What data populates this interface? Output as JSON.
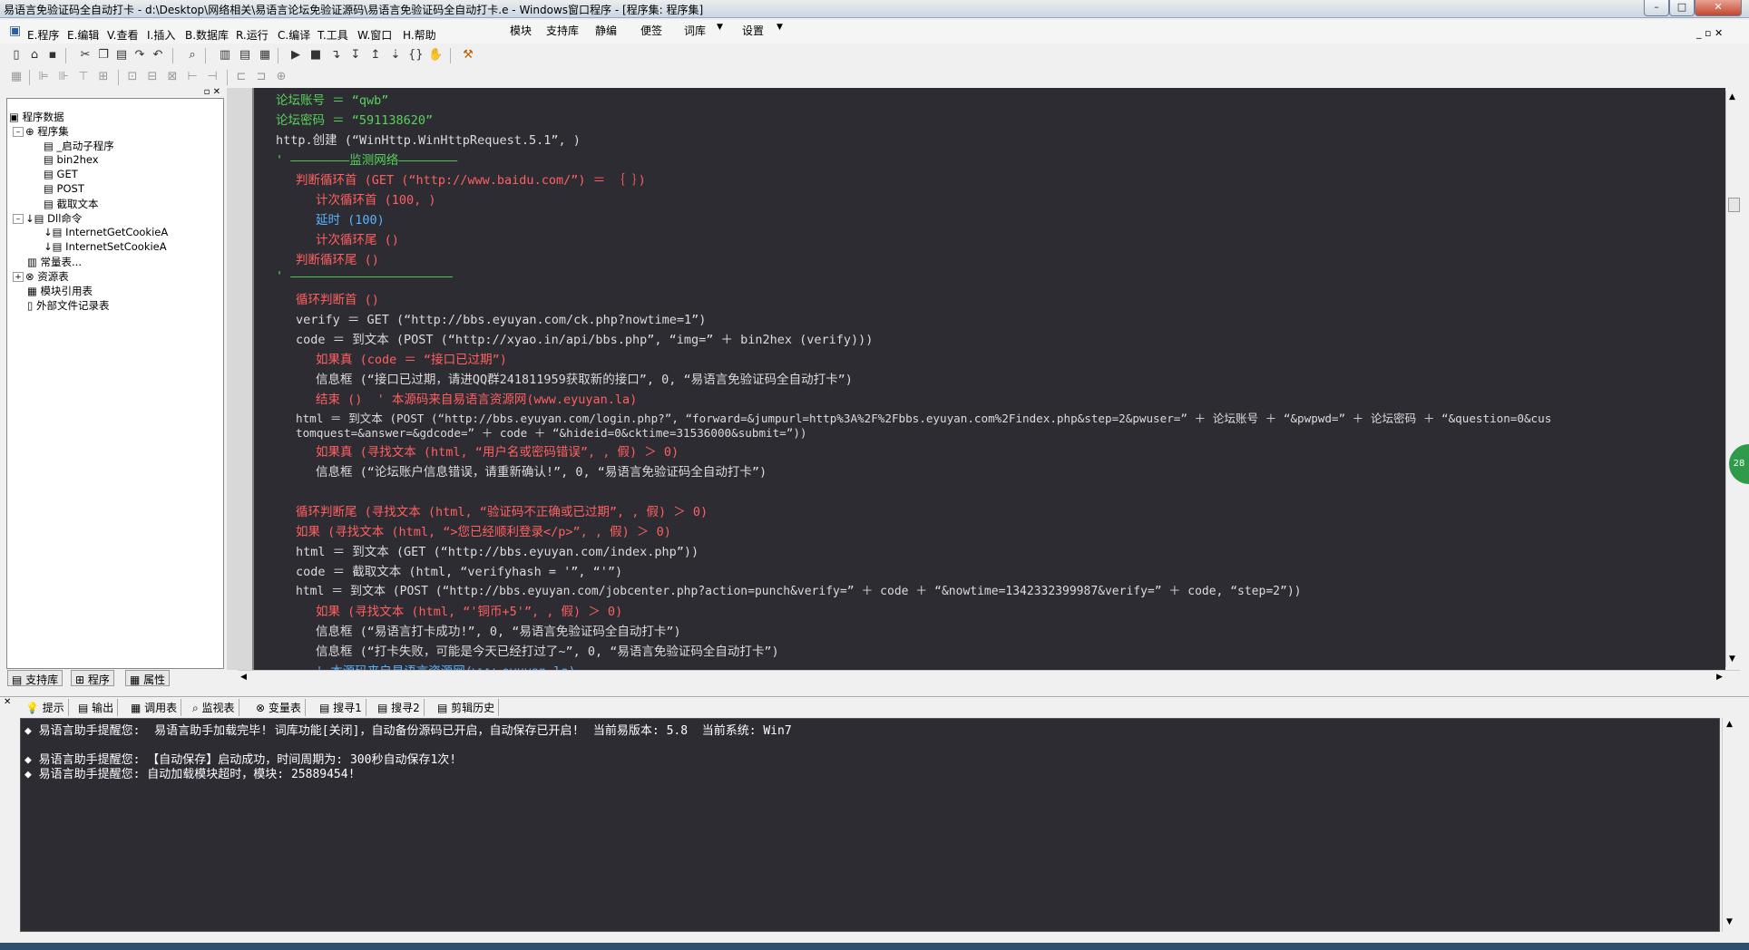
{
  "window": {
    "title": "易语言免验证码全自动打卡 - d:\\Desktop\\网络相关\\易语言论坛免验证源码\\易语言免验证码全自动打卡.e - Windows窗口程序 - [程序集: 程序集]",
    "min": "–",
    "max": "□",
    "close": "✕"
  },
  "menu": [
    "E.程序",
    "E.编辑",
    "V.查看",
    "I.插入",
    "B.数据库",
    "R.运行",
    "C.编译",
    "T.工具",
    "W.窗口",
    "H.帮助"
  ],
  "topmenu": [
    "模块",
    "支持库",
    "静编",
    "便签",
    "词库",
    "设置"
  ],
  "tree": {
    "root": "程序数据",
    "assembly": "程序集",
    "items": [
      "_启动子程序",
      "bin2hex",
      "GET",
      "POST",
      "截取文本"
    ],
    "dll": "Dll命令",
    "dll_items": [
      "InternetGetCookieA",
      "InternetSetCookieA"
    ],
    "consts": "常量表...",
    "resources": "资源表",
    "modref": "模块引用表",
    "external": "外部文件记录表"
  },
  "left_tabs": [
    "支持库",
    "程序",
    "属性"
  ],
  "code": [
    "论坛账号 ＝ “qwb”",
    "论坛密码 ＝ “591138620”",
    "http.创建 (“WinHttp.WinHttpRequest.5.1”, )",
    "' ————————监测网络————————",
    "判断循环首 (GET (“http://www.baidu.com/”) ＝ ｛ ｝)",
    "计次循环首 (100, )",
    "延时 (100)",
    "计次循环尾 ()",
    "判断循环尾 ()",
    "' ——————————————————————",
    "循环判断首 ()",
    "verify ＝ GET (“http://bbs.eyuyan.com/ck.php?nowtime=1”)",
    "code ＝ 到文本 (POST (“http://xyao.in/api/bbs.php”, “img=” ＋ bin2hex (verify)))",
    "如果真 (code ＝ “接口已过期”)",
    "信息框 (“接口已过期，请进QQ群241811959获取新的接口”, 0, “易语言免验证码全自动打卡”)",
    "结束 ()  ' 本源码来自易语言资源网(www.eyuyan.la)",
    "html ＝ 到文本 (POST (“http://bbs.eyuyan.com/login.php?”, “forward=&jumpurl=http%3A%2F%2Fbbs.eyuyan.com%2Findex.php&step=2&pwuser=” ＋ 论坛账号 ＋ “&pwpwd=” ＋ 论坛密码 ＋ “&question=0&cus",
    "tomquest=&answer=&gdcode=” ＋ code ＋ “&hideid=0&cktime=31536000&submit=”))",
    "如果真 (寻找文本 (html, “用户名或密码错误”, , 假) ＞ 0)",
    "信息框 (“论坛账户信息错误，请重新确认!”, 0, “易语言免验证码全自动打卡”)",
    "循环判断尾 (寻找文本 (html, “验证码不正确或已过期”, , 假) ＞ 0)",
    "如果 (寻找文本 (html, “>您已经顺利登录</p>”, , 假) ＞ 0)",
    "html ＝ 到文本 (GET (“http://bbs.eyuyan.com/index.php”))",
    "code ＝ 截取文本 (html, “verifyhash = '”, “'”)",
    "html ＝ 到文本 (POST (“http://bbs.eyuyan.com/jobcenter.php?action=punch&verify=” ＋ code ＋ “&nowtime=1342332399987&verify=” ＋ code, “step=2”))",
    "如果 (寻找文本 (html, “'铜币+5'”, , 假) ＞ 0)",
    "信息框 (“易语言打卡成功!”, 0, “易语言免验证码全自动打卡”)",
    "信息框 (“打卡失败，可能是今天已经打过了~”, 0, “易语言免验证码全自动打卡”)",
    "' 本源码来自易语言资源网(www.eyuyan.la)"
  ],
  "bottom_tabs": [
    "提示",
    "输出",
    "调用表",
    "监视表",
    "变量表",
    "搜寻1",
    "搜寻2",
    "剪辑历史"
  ],
  "output": [
    "◆ 易语言助手提醒您:  易语言助手加载完毕! 词库功能[关闭]，自动备份源码已开启，自动保存已开启!  当前易版本: 5.8  当前系统: Win7",
    "◆ 易语言助手提醒您: 【自动保存】启动成功，时间周期为: 300秒自动保存1次!",
    "◆ 易语言助手提醒您: 自动加载模块超时，模块: 25889454!"
  ],
  "badge": "28",
  "colors": {
    "editor_bg": "#2c2c32",
    "keyword": "#ff6060",
    "function": "#5ab2ff",
    "variable": "#5ad25a"
  }
}
